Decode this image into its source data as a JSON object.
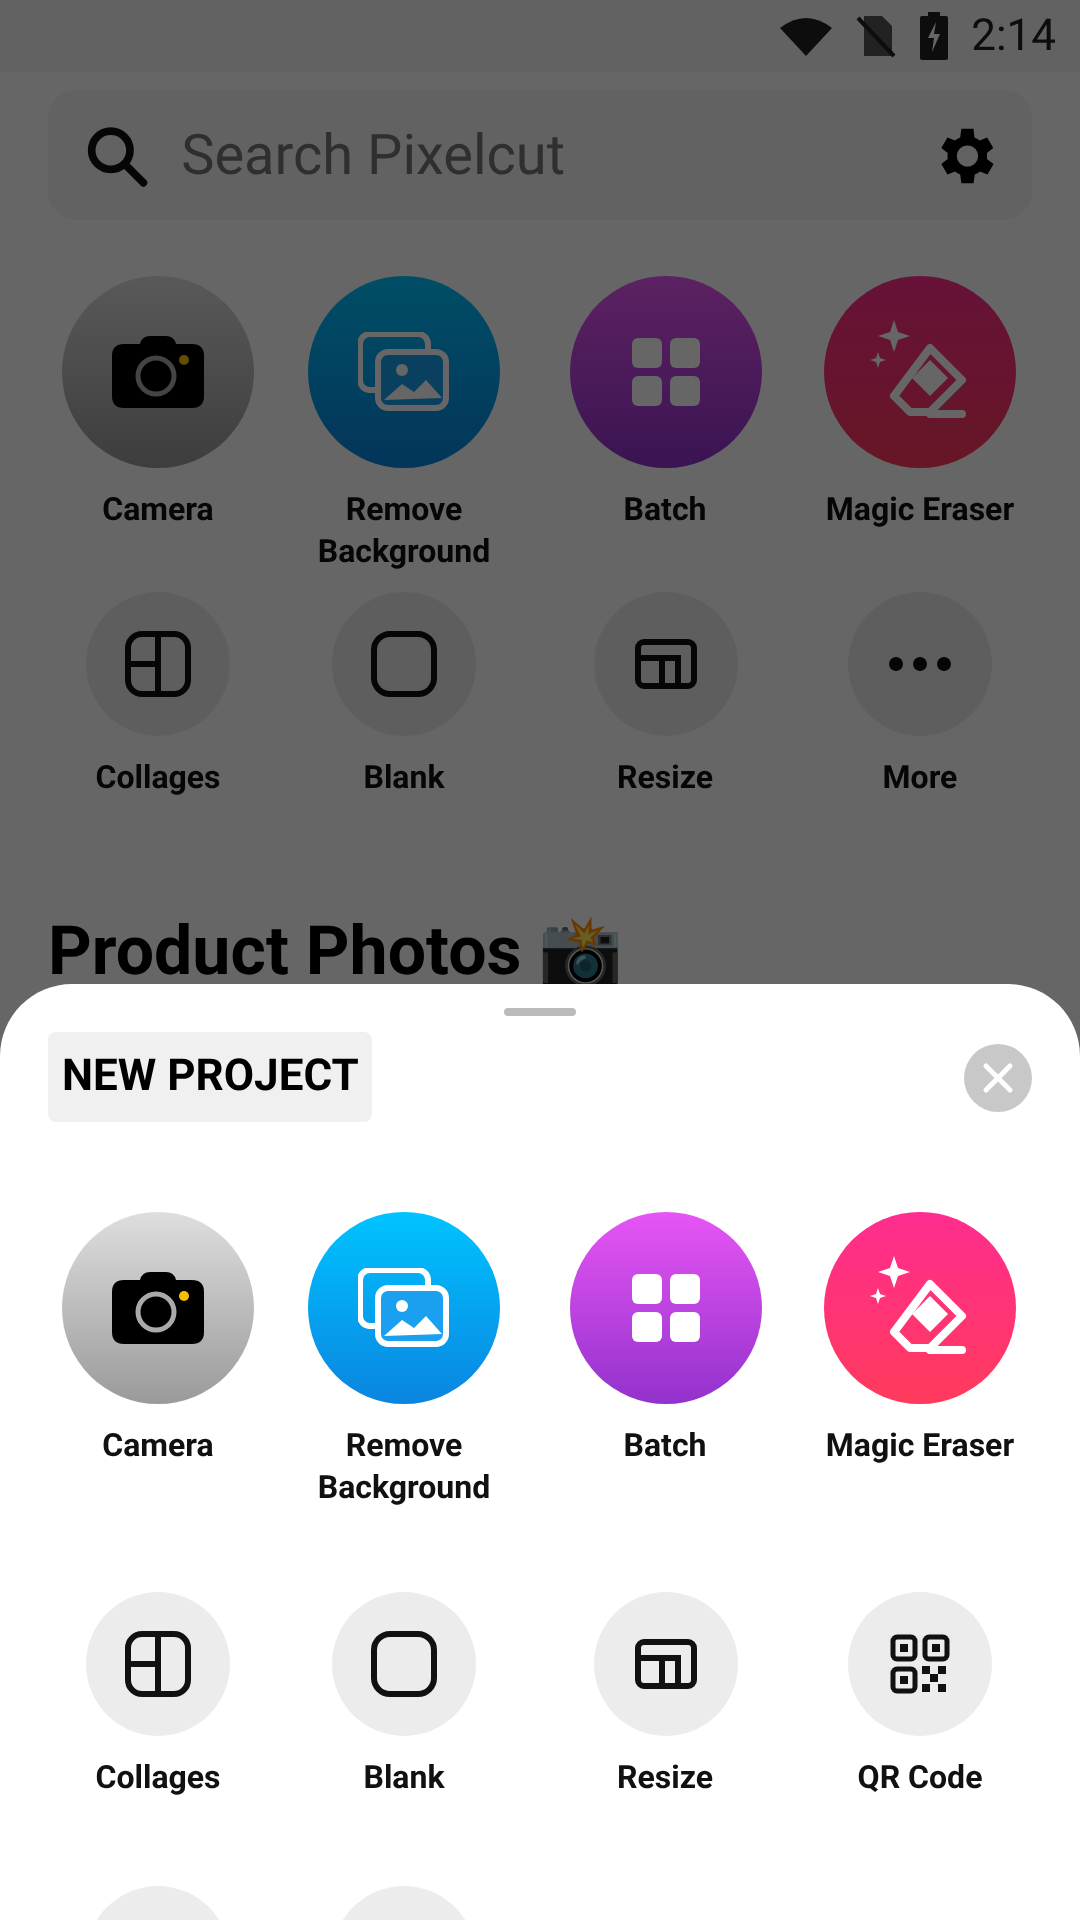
{
  "status_bar": {
    "time": "2:14"
  },
  "search": {
    "placeholder": "Search Pixelcut"
  },
  "featured": [
    {
      "label": "Camera",
      "kind": "camera"
    },
    {
      "label": "Remove\nBackground",
      "kind": "images"
    },
    {
      "label": "Batch",
      "kind": "grid"
    },
    {
      "label": "Magic Eraser",
      "kind": "eraser"
    }
  ],
  "tools": [
    {
      "label": "Collages",
      "kind": "collage"
    },
    {
      "label": "Blank",
      "kind": "blank"
    },
    {
      "label": "Resize",
      "kind": "resize"
    },
    {
      "label": "More",
      "kind": "more"
    }
  ],
  "section_title": "Product Photos 📸",
  "sheet": {
    "title": "NEW PROJECT",
    "featured": [
      {
        "label": "Camera",
        "kind": "camera"
      },
      {
        "label": "Remove\nBackground",
        "kind": "images"
      },
      {
        "label": "Batch",
        "kind": "grid"
      },
      {
        "label": "Magic Eraser",
        "kind": "eraser"
      }
    ],
    "tools": [
      {
        "label": "Collages",
        "kind": "collage"
      },
      {
        "label": "Blank",
        "kind": "blank"
      },
      {
        "label": "Resize",
        "kind": "resize"
      },
      {
        "label": "QR Code",
        "kind": "qr"
      },
      {
        "kind": "partial"
      },
      {
        "kind": "partial"
      }
    ]
  }
}
